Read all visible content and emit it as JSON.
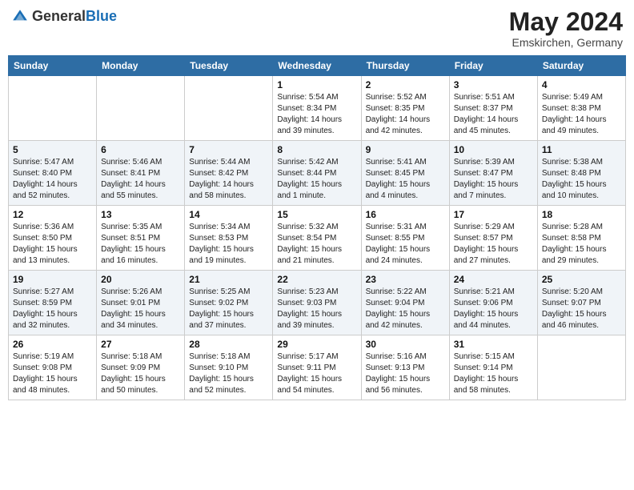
{
  "header": {
    "logo_general": "General",
    "logo_blue": "Blue",
    "month_title": "May 2024",
    "subtitle": "Emskirchen, Germany"
  },
  "days_of_week": [
    "Sunday",
    "Monday",
    "Tuesday",
    "Wednesday",
    "Thursday",
    "Friday",
    "Saturday"
  ],
  "weeks": [
    [
      {
        "day": "",
        "info": ""
      },
      {
        "day": "",
        "info": ""
      },
      {
        "day": "",
        "info": ""
      },
      {
        "day": "1",
        "info": "Sunrise: 5:54 AM\nSunset: 8:34 PM\nDaylight: 14 hours\nand 39 minutes."
      },
      {
        "day": "2",
        "info": "Sunrise: 5:52 AM\nSunset: 8:35 PM\nDaylight: 14 hours\nand 42 minutes."
      },
      {
        "day": "3",
        "info": "Sunrise: 5:51 AM\nSunset: 8:37 PM\nDaylight: 14 hours\nand 45 minutes."
      },
      {
        "day": "4",
        "info": "Sunrise: 5:49 AM\nSunset: 8:38 PM\nDaylight: 14 hours\nand 49 minutes."
      }
    ],
    [
      {
        "day": "5",
        "info": "Sunrise: 5:47 AM\nSunset: 8:40 PM\nDaylight: 14 hours\nand 52 minutes."
      },
      {
        "day": "6",
        "info": "Sunrise: 5:46 AM\nSunset: 8:41 PM\nDaylight: 14 hours\nand 55 minutes."
      },
      {
        "day": "7",
        "info": "Sunrise: 5:44 AM\nSunset: 8:42 PM\nDaylight: 14 hours\nand 58 minutes."
      },
      {
        "day": "8",
        "info": "Sunrise: 5:42 AM\nSunset: 8:44 PM\nDaylight: 15 hours\nand 1 minute."
      },
      {
        "day": "9",
        "info": "Sunrise: 5:41 AM\nSunset: 8:45 PM\nDaylight: 15 hours\nand 4 minutes."
      },
      {
        "day": "10",
        "info": "Sunrise: 5:39 AM\nSunset: 8:47 PM\nDaylight: 15 hours\nand 7 minutes."
      },
      {
        "day": "11",
        "info": "Sunrise: 5:38 AM\nSunset: 8:48 PM\nDaylight: 15 hours\nand 10 minutes."
      }
    ],
    [
      {
        "day": "12",
        "info": "Sunrise: 5:36 AM\nSunset: 8:50 PM\nDaylight: 15 hours\nand 13 minutes."
      },
      {
        "day": "13",
        "info": "Sunrise: 5:35 AM\nSunset: 8:51 PM\nDaylight: 15 hours\nand 16 minutes."
      },
      {
        "day": "14",
        "info": "Sunrise: 5:34 AM\nSunset: 8:53 PM\nDaylight: 15 hours\nand 19 minutes."
      },
      {
        "day": "15",
        "info": "Sunrise: 5:32 AM\nSunset: 8:54 PM\nDaylight: 15 hours\nand 21 minutes."
      },
      {
        "day": "16",
        "info": "Sunrise: 5:31 AM\nSunset: 8:55 PM\nDaylight: 15 hours\nand 24 minutes."
      },
      {
        "day": "17",
        "info": "Sunrise: 5:29 AM\nSunset: 8:57 PM\nDaylight: 15 hours\nand 27 minutes."
      },
      {
        "day": "18",
        "info": "Sunrise: 5:28 AM\nSunset: 8:58 PM\nDaylight: 15 hours\nand 29 minutes."
      }
    ],
    [
      {
        "day": "19",
        "info": "Sunrise: 5:27 AM\nSunset: 8:59 PM\nDaylight: 15 hours\nand 32 minutes."
      },
      {
        "day": "20",
        "info": "Sunrise: 5:26 AM\nSunset: 9:01 PM\nDaylight: 15 hours\nand 34 minutes."
      },
      {
        "day": "21",
        "info": "Sunrise: 5:25 AM\nSunset: 9:02 PM\nDaylight: 15 hours\nand 37 minutes."
      },
      {
        "day": "22",
        "info": "Sunrise: 5:23 AM\nSunset: 9:03 PM\nDaylight: 15 hours\nand 39 minutes."
      },
      {
        "day": "23",
        "info": "Sunrise: 5:22 AM\nSunset: 9:04 PM\nDaylight: 15 hours\nand 42 minutes."
      },
      {
        "day": "24",
        "info": "Sunrise: 5:21 AM\nSunset: 9:06 PM\nDaylight: 15 hours\nand 44 minutes."
      },
      {
        "day": "25",
        "info": "Sunrise: 5:20 AM\nSunset: 9:07 PM\nDaylight: 15 hours\nand 46 minutes."
      }
    ],
    [
      {
        "day": "26",
        "info": "Sunrise: 5:19 AM\nSunset: 9:08 PM\nDaylight: 15 hours\nand 48 minutes."
      },
      {
        "day": "27",
        "info": "Sunrise: 5:18 AM\nSunset: 9:09 PM\nDaylight: 15 hours\nand 50 minutes."
      },
      {
        "day": "28",
        "info": "Sunrise: 5:18 AM\nSunset: 9:10 PM\nDaylight: 15 hours\nand 52 minutes."
      },
      {
        "day": "29",
        "info": "Sunrise: 5:17 AM\nSunset: 9:11 PM\nDaylight: 15 hours\nand 54 minutes."
      },
      {
        "day": "30",
        "info": "Sunrise: 5:16 AM\nSunset: 9:13 PM\nDaylight: 15 hours\nand 56 minutes."
      },
      {
        "day": "31",
        "info": "Sunrise: 5:15 AM\nSunset: 9:14 PM\nDaylight: 15 hours\nand 58 minutes."
      },
      {
        "day": "",
        "info": ""
      }
    ]
  ]
}
